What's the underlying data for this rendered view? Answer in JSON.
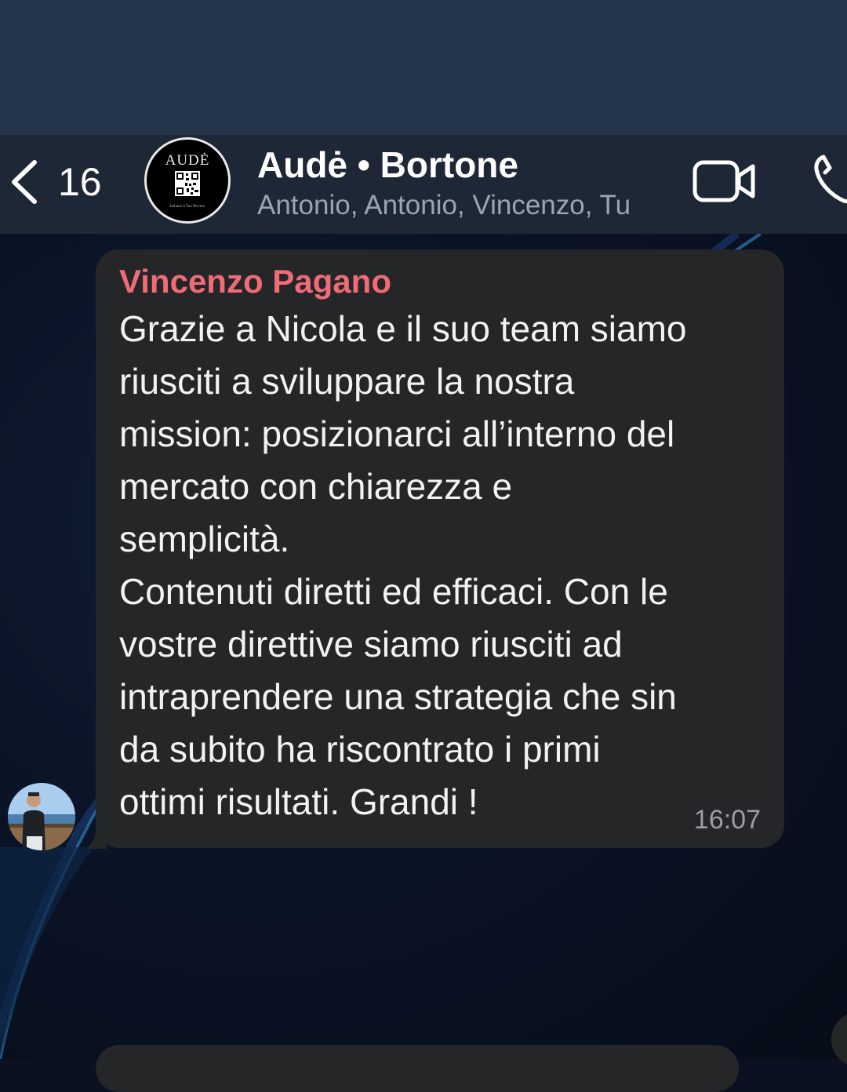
{
  "header": {
    "back_count": "16",
    "title": "Audė • Bortone",
    "subtitle": "Antonio, Antonio, Vincenzo, Tu",
    "avatar_logo_text": "AUDĖ",
    "avatar_caption": "Italiana il Tuo Piccolo"
  },
  "message": {
    "sender": "Vincenzo Pagano",
    "lines": [
      "Grazie a Nicola e il suo team siamo",
      "riusciti a sviluppare la nostra",
      "mission: posizionarci all’interno del",
      "mercato con chiarezza e",
      "semplicità.",
      "Contenuti diretti ed efficaci. Con le",
      "vostre direttive siamo riusciti ad",
      "intraprendere una strategia che sin",
      "da subito ha riscontrato i primi",
      "ottimi risultati. Grandi !"
    ],
    "time": "16:07"
  },
  "icons": {
    "back": "chevron-left-icon",
    "video": "video-camera-icon",
    "phone": "phone-icon"
  },
  "colors": {
    "sender_name": "#f06b78",
    "bubble": "#242628",
    "header": "#1d2735"
  }
}
